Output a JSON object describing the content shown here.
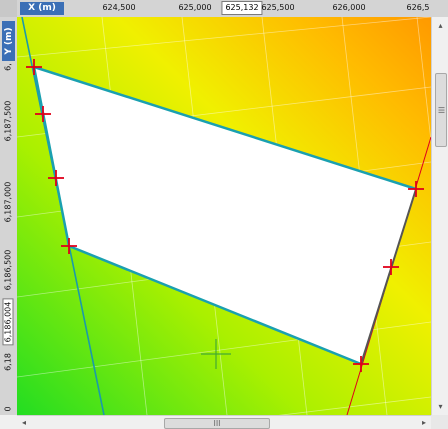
{
  "rulers": {
    "x_label": "X (m)",
    "y_label": "Y (m)",
    "x_ticks": [
      "624,500",
      "625,000",
      "625,500",
      "626,000",
      "626,5"
    ],
    "x_cursor": "625,132",
    "y_ticks": [
      "6,",
      "6,187,500",
      "6,187,000",
      "6,186,500",
      "6,186,004",
      "6,18",
      "0"
    ]
  },
  "map": {
    "gradient_colors": [
      "#22dd22",
      "#aaf000",
      "#f0f000",
      "#ffbb00",
      "#ff9900"
    ],
    "polygon_color": "#1aa0b0",
    "vertex_color": "#e0001a",
    "cursor_color": "#44aa33"
  },
  "scrollbars": {
    "left_arrow": "◂",
    "right_arrow": "▸",
    "up_arrow": "▴",
    "down_arrow": "▾",
    "grip": "III"
  }
}
